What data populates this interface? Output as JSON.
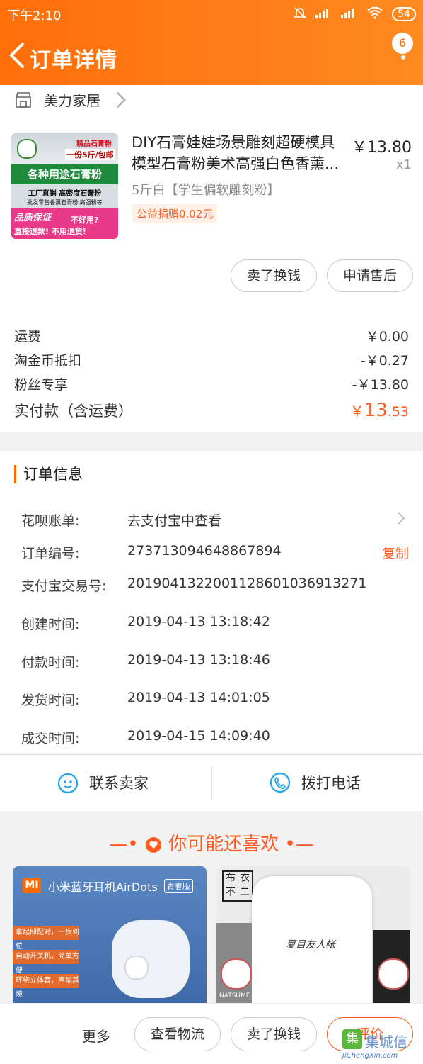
{
  "status_bar": {
    "time": "下午2:10",
    "battery": "54"
  },
  "header": {
    "title": "订单详情",
    "badge": "6"
  },
  "shop": {
    "name": "美力家居"
  },
  "product": {
    "title": "DIY石膏娃娃场景雕刻超硬模具模型石膏粉美术高强白色香薰...",
    "price": "￥13.80",
    "qty": "x1",
    "sku": "5斤白【学生偏软雕刻粉】",
    "charity_tag": "公益捐赠0.02元",
    "image_text": {
      "line1": "精品石膏粉",
      "line2": "一份5斤/包邮",
      "line3": "各种用途石膏粉",
      "line4": "工厂直销  高密度石膏粉",
      "line5": "批发零售香薰石膏粉,高强粉等",
      "line6": "品质保证",
      "line7": "不好用?",
      "line8": "直接退款! 不用退货!"
    }
  },
  "actions": {
    "sell": "卖了换钱",
    "after_sale": "申请售后"
  },
  "summary": [
    {
      "label": "运费",
      "value": "￥0.00"
    },
    {
      "label": "淘金币抵扣",
      "value": "-￥0.27"
    },
    {
      "label": "粉丝专享",
      "value": "-￥13.80"
    }
  ],
  "total": {
    "label": "实付款（含运费）",
    "currency": "￥",
    "integer": "13",
    "decimal": ".53"
  },
  "order_info": {
    "title": "订单信息",
    "rows": [
      {
        "label": "花呗账单:",
        "value": "去支付宝中查看"
      },
      {
        "label": "订单编号:",
        "value": "273713094648867894",
        "action": "复制"
      },
      {
        "label": "支付宝交易号:",
        "value": "2019041322001128601036913271"
      },
      {
        "label": "创建时间:",
        "value": "2019-04-13 13:18:42"
      },
      {
        "label": "付款时间:",
        "value": "2019-04-13 13:18:46"
      },
      {
        "label": "发货时间:",
        "value": "2019-04-13 14:01:05"
      },
      {
        "label": "成交时间:",
        "value": "2019-04-15 14:09:40"
      }
    ]
  },
  "contact": {
    "seller": "联系卖家",
    "phone": "拨打电话"
  },
  "recommend": {
    "title": "你可能还喜欢",
    "card1": {
      "brand": "MI",
      "title": "小米蓝牙耳机AirDots",
      "badge": "青春版",
      "features": [
        "拿起即配对，一步到位",
        "自动开关机，简单方便",
        "环绕立体音，声临其境"
      ]
    },
    "card2": {
      "logo": [
        "布",
        "衣",
        "不",
        "二"
      ],
      "shirt_text": "夏目友人帐",
      "side_text": "NATSUME TA"
    }
  },
  "bottom_bar": {
    "more": "更多",
    "logistics": "查看物流",
    "sell": "卖了换钱",
    "review": "评价"
  },
  "watermark": {
    "text": "集城信",
    "url": "JiChengXin.com"
  },
  "colors": {
    "accent": "#ff6a00",
    "price": "#ff5a1f"
  }
}
